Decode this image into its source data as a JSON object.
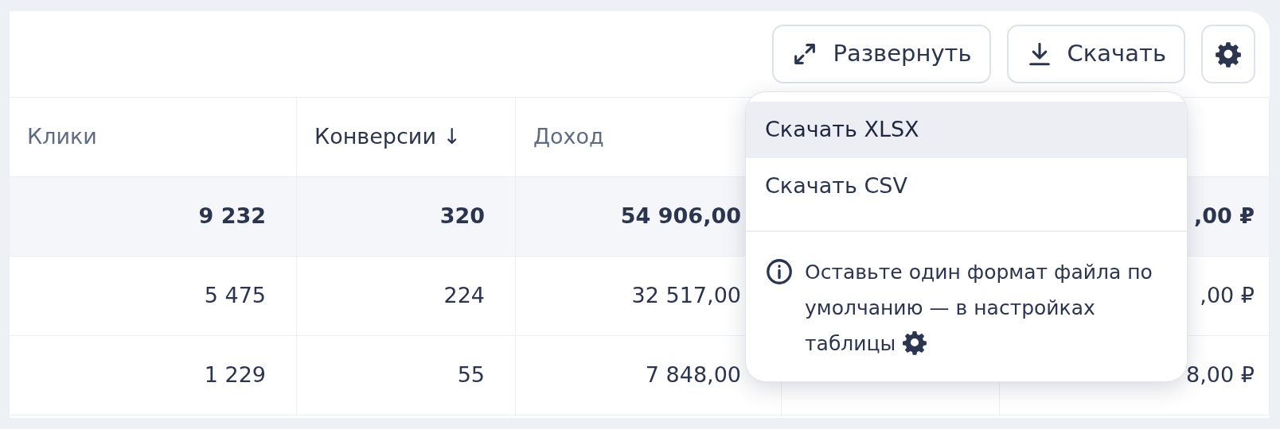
{
  "toolbar": {
    "buttons": [
      {
        "label": "Развернуть",
        "kind": "expand"
      },
      {
        "label": "Скачать",
        "kind": "download"
      },
      {
        "kind": "settings"
      }
    ]
  },
  "table": {
    "columns": [
      {
        "label": "Клики",
        "sorted": false
      },
      {
        "label": "Конверсии",
        "sorted": true,
        "sort_mark": "↓"
      },
      {
        "label": "Доход",
        "sorted": false
      },
      {},
      {}
    ],
    "rows": [
      {
        "total": true,
        "cells": [
          "9 232",
          "320",
          "54 906,00",
          "",
          ",00 ₽"
        ]
      },
      {
        "total": false,
        "cells": [
          "5 475",
          "224",
          "32 517,00",
          "",
          ",00 ₽"
        ]
      },
      {
        "total": false,
        "cells": [
          "1 229",
          "55",
          "7 848,00",
          "",
          "8,00 ₽"
        ]
      }
    ]
  },
  "download_menu": {
    "items": [
      {
        "label": "Скачать XLSX",
        "selected": true
      },
      {
        "label": "Скачать CSV",
        "selected": false
      }
    ],
    "hint": "Оставьте один формат файла по умолчанию — в настройках таблицы"
  }
}
